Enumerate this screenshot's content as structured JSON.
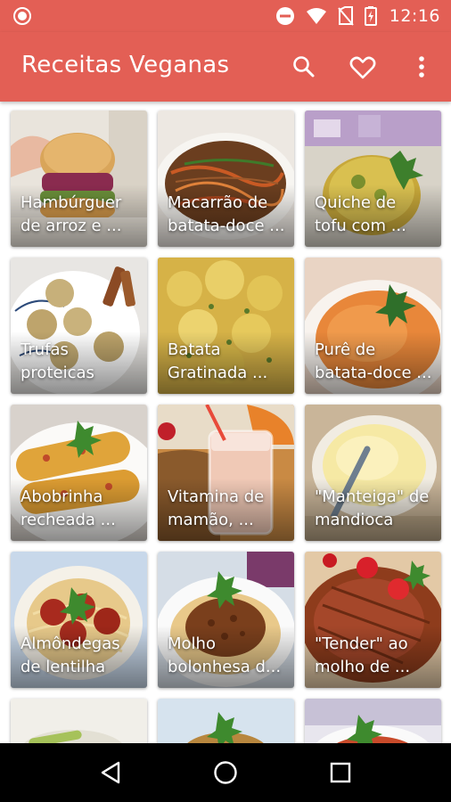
{
  "status_bar": {
    "time": "12:16"
  },
  "app_bar": {
    "title": "Receitas Veganas"
  },
  "recipes": [
    {
      "line1": "Hambúrguer",
      "line2": "de arroz e ..."
    },
    {
      "line1": "Macarrão de",
      "line2": "batata-doce ..."
    },
    {
      "line1": "Quiche de",
      "line2": "tofu com ..."
    },
    {
      "line1": "Trufas",
      "line2": "proteicas"
    },
    {
      "line1": "Batata",
      "line2": "Gratinada ..."
    },
    {
      "line1": "Purê de",
      "line2": "batata-doce ..."
    },
    {
      "line1": "Abobrinha",
      "line2": "recheada ..."
    },
    {
      "line1": "Vitamina de",
      "line2": "mamão, ..."
    },
    {
      "line1": "\"Manteiga\" de",
      "line2": "mandioca"
    },
    {
      "line1": "Almôndegas",
      "line2": "de lentilha"
    },
    {
      "line1": "Molho",
      "line2": "bolonhesa d..."
    },
    {
      "line1": "\"Tender\" ao",
      "line2": "molho de ..."
    }
  ],
  "colors": {
    "primary": "#e35f55",
    "nav": "#000000"
  }
}
